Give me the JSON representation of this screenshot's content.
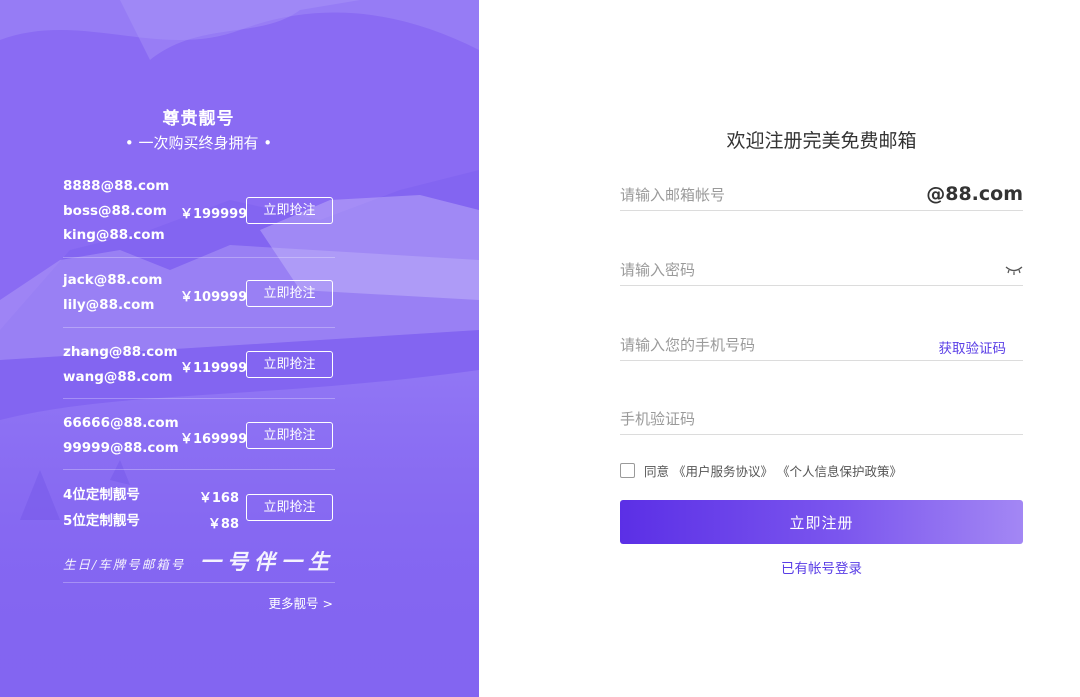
{
  "promo": {
    "title": "尊贵靓号",
    "subtitle": "• 一次购买终身拥有 •",
    "offers": [
      {
        "emails": [
          "8888@88.com",
          "boss@88.com",
          "king@88.com"
        ],
        "price": "￥199999",
        "button": "立即抢注"
      },
      {
        "emails": [
          "jack@88.com",
          "lily@88.com"
        ],
        "price": "￥109999",
        "button": "立即抢注"
      },
      {
        "emails": [
          "zhang@88.com",
          "wang@88.com"
        ],
        "price": "￥119999",
        "button": "立即抢注"
      },
      {
        "emails": [
          "66666@88.com",
          "99999@88.com"
        ],
        "price": "￥169999",
        "button": "立即抢注"
      },
      {
        "emails": [
          "4位定制靓号",
          "5位定制靓号"
        ],
        "prices": [
          "￥168",
          "￥88"
        ],
        "button": "立即抢注"
      }
    ],
    "slogan_small": "生日/车牌号邮箱号",
    "slogan_big": "一号伴一生",
    "more_link": "更多靓号 >"
  },
  "form": {
    "title": "欢迎注册完美免费邮箱",
    "email_placeholder": "请输入邮箱帐号",
    "email_suffix": "@88.com",
    "password_placeholder": "请输入密码",
    "phone_placeholder": "请输入您的手机号码",
    "get_code_label": "获取验证码",
    "code_placeholder": "手机验证码",
    "agree_prefix": "同意",
    "terms_link": "《用户服务协议》",
    "privacy_link": "《个人信息保护政策》",
    "submit_label": "立即注册",
    "login_link": "已有帐号登录"
  },
  "colors": {
    "panel_purple": "#8b6cf4",
    "accent": "#5a3ee6",
    "button_gradient_start": "#5b2fe6",
    "button_gradient_end": "#a387f4"
  },
  "icons": {
    "password_toggle": "closed-eye-icon"
  }
}
